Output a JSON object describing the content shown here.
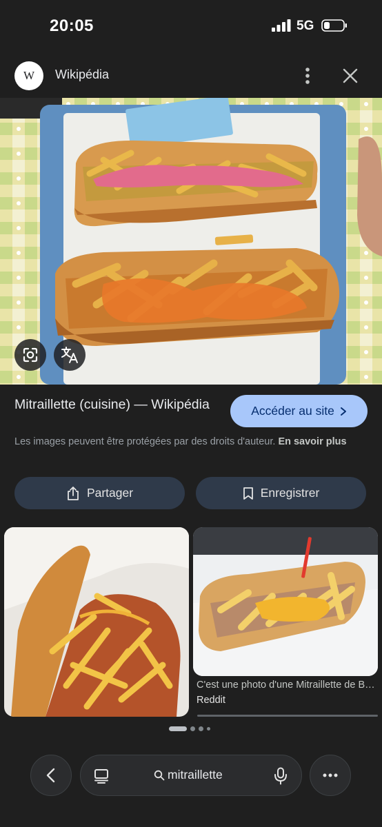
{
  "status_bar": {
    "time": "20:05",
    "network": "5G",
    "icons": [
      "signal-icon",
      "battery-icon"
    ]
  },
  "header": {
    "logo_text": "W",
    "site_name": "Wikipédia",
    "icons": [
      "more-vert-icon",
      "close-icon"
    ]
  },
  "main_image": {
    "icons": [
      "lens-icon",
      "translate-icon"
    ]
  },
  "result": {
    "title": "Mitraillette (cuisine) — Wikipédia",
    "visit_label": "Accéder au site",
    "copyright_text": "Les images peuvent être protégées par des droits d'auteur.",
    "learn_more": "En savoir plus"
  },
  "actions": {
    "share_label": "Partager",
    "save_label": "Enregistrer"
  },
  "related": [
    {
      "caption": "",
      "source": ""
    },
    {
      "caption": "C'est une photo d'une Mitraillette de Bruxelles",
      "source": "Reddit"
    }
  ],
  "bottom_bar": {
    "query": "mitraillette",
    "icons": [
      "back-icon",
      "tabs-icon",
      "search-icon",
      "mic-icon",
      "more-horiz-icon"
    ]
  },
  "colors": {
    "background": "#1f1f1f",
    "accent_button": "#a8c7fa",
    "secondary_button": "#2f3a4a"
  }
}
